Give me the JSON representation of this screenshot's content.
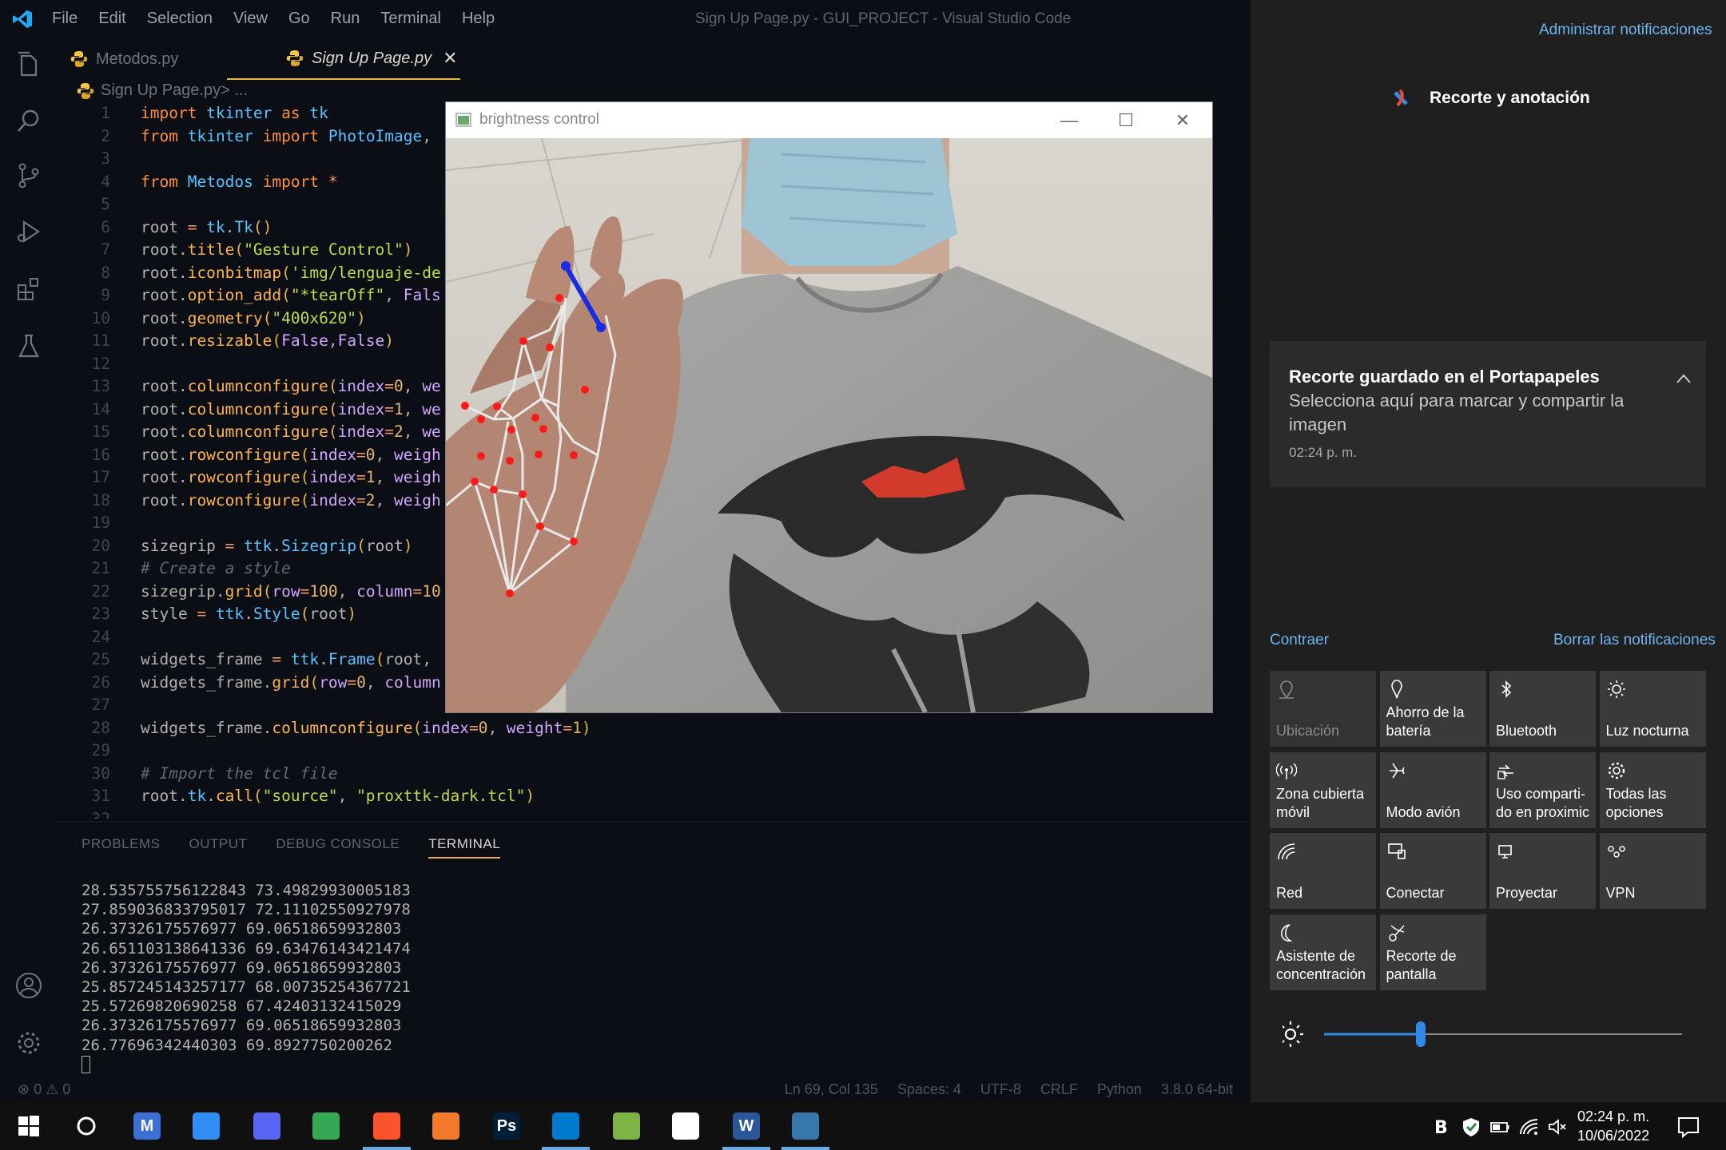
{
  "vscode": {
    "menu": [
      "File",
      "Edit",
      "Selection",
      "View",
      "Go",
      "Run",
      "Terminal",
      "Help"
    ],
    "window_title": "Sign Up Page.py - GUI_PROJECT - Visual Studio Code",
    "tabs": [
      {
        "label": "Metodos.py",
        "active": false
      },
      {
        "label": "Sign Up Page.py",
        "active": true,
        "close": "✕"
      }
    ],
    "breadcrumb": {
      "file": "Sign Up Page.py",
      "rest": " > ..."
    },
    "code_lines": [
      {
        "n": "1",
        "html": "<span class='kw'>import</span> <span class='mod'>tkinter</span> <span class='kw'>as</span> <span class='mod'>tk</span>"
      },
      {
        "n": "2",
        "html": "<span class='kw'>from</span> <span class='mod'>tkinter</span> <span class='kw'>import</span> <span class='mod'>PhotoImage</span>,"
      },
      {
        "n": "3",
        "html": ""
      },
      {
        "n": "4",
        "html": "<span class='kw'>from</span> <span class='mod'>Metodos</span> <span class='kw'>import</span> <span class='op'>*</span>"
      },
      {
        "n": "5",
        "html": ""
      },
      {
        "n": "6",
        "html": "root <span class='op'>=</span> <span class='mod'>tk</span>.<span class='mod'>Tk</span><span class='par'>()</span>"
      },
      {
        "n": "7",
        "html": "root.<span class='fn'>title</span><span class='par'>(</span><span class='str'>\"Gesture Control\"</span><span class='par'>)</span>"
      },
      {
        "n": "8",
        "html": "root.<span class='fn'>iconbitmap</span><span class='par'>(</span><span class='str'>'img/lenguaje-de</span>"
      },
      {
        "n": "9",
        "html": "root.<span class='fn'>option_add</span><span class='par'>(</span><span class='str'>\"*tearOff\"</span>, <span class='prm'>Fals</span>"
      },
      {
        "n": "10",
        "html": "root.<span class='fn'>geometry</span><span class='par'>(</span><span class='str'>\"400x620\"</span><span class='par'>)</span>"
      },
      {
        "n": "11",
        "html": "root.<span class='fn'>resizable</span><span class='par'>(</span><span class='prm'>False</span>,<span class='prm'>False</span><span class='par'>)</span>"
      },
      {
        "n": "12",
        "html": ""
      },
      {
        "n": "13",
        "html": "root.<span class='fn'>columnconfigure</span><span class='par'>(</span><span class='prm'>index</span><span class='op'>=</span><span class='num'>0</span>, <span class='prm'>we</span>"
      },
      {
        "n": "14",
        "html": "root.<span class='fn'>columnconfigure</span><span class='par'>(</span><span class='prm'>index</span><span class='op'>=</span><span class='num'>1</span>, <span class='prm'>we</span>"
      },
      {
        "n": "15",
        "html": "root.<span class='fn'>columnconfigure</span><span class='par'>(</span><span class='prm'>index</span><span class='op'>=</span><span class='num'>2</span>, <span class='prm'>we</span>"
      },
      {
        "n": "16",
        "html": "root.<span class='fn'>rowconfigure</span><span class='par'>(</span><span class='prm'>index</span><span class='op'>=</span><span class='num'>0</span>, <span class='prm'>weigh</span>"
      },
      {
        "n": "17",
        "html": "root.<span class='fn'>rowconfigure</span><span class='par'>(</span><span class='prm'>index</span><span class='op'>=</span><span class='num'>1</span>, <span class='prm'>weigh</span>"
      },
      {
        "n": "18",
        "html": "root.<span class='fn'>rowconfigure</span><span class='par'>(</span><span class='prm'>index</span><span class='op'>=</span><span class='num'>2</span>, <span class='prm'>weigh</span>"
      },
      {
        "n": "19",
        "html": ""
      },
      {
        "n": "20",
        "html": "sizegrip <span class='op'>=</span> <span class='mod'>ttk</span>.<span class='mod'>Sizegrip</span><span class='par'>(</span>root<span class='par'>)</span>"
      },
      {
        "n": "21",
        "html": "<span class='cm'># Create a style</span>"
      },
      {
        "n": "22",
        "html": "sizegrip.<span class='fn'>grid</span><span class='par'>(</span><span class='prm'>row</span><span class='op'>=</span><span class='num'>100</span>, <span class='prm'>column</span><span class='op'>=</span><span class='num'>10</span>"
      },
      {
        "n": "23",
        "html": "style <span class='op'>=</span> <span class='mod'>ttk</span>.<span class='mod'>Style</span><span class='par'>(</span>root<span class='par'>)</span>"
      },
      {
        "n": "24",
        "html": ""
      },
      {
        "n": "25",
        "html": "widgets_frame <span class='op'>=</span> <span class='mod'>ttk</span>.<span class='mod'>Frame</span><span class='par'>(</span>root,"
      },
      {
        "n": "26",
        "html": "widgets_frame.<span class='fn'>grid</span><span class='par'>(</span><span class='prm'>row</span><span class='op'>=</span><span class='num'>0</span>, <span class='prm'>column</span>"
      },
      {
        "n": "27",
        "html": ""
      },
      {
        "n": "28",
        "html": "widgets_frame.<span class='fn'>columnconfigure</span><span class='par'>(</span><span class='prm'>index</span><span class='op'>=</span><span class='num'>0</span>, <span class='prm'>weight</span><span class='op'>=</span><span class='num'>1</span><span class='par'>)</span>"
      },
      {
        "n": "29",
        "html": ""
      },
      {
        "n": "30",
        "html": "<span class='cm'># Import the tcl file</span>"
      },
      {
        "n": "31",
        "html": "root.<span class='mod'>tk</span>.<span class='fn'>call</span><span class='par'>(</span><span class='str'>\"source\"</span>, <span class='str'>\"proxttk-dark.tcl\"</span><span class='par'>)</span>"
      },
      {
        "n": "32",
        "html": ""
      }
    ],
    "panel_tabs": [
      "PROBLEMS",
      "OUTPUT",
      "DEBUG CONSOLE",
      "TERMINAL"
    ],
    "panel_active": "TERMINAL",
    "terminal_lines": [
      "28.535755756122843 73.49829930005183",
      "27.859036833795017 72.11102550927978",
      "26.37326175576977 69.06518659932803",
      "26.651103138641336 69.63476143421474",
      "26.37326175576977 69.06518659932803",
      "25.857245143257177 68.00735254367721",
      "25.57269820690258 67.42403132415029",
      "26.37326175576977 69.06518659932803",
      "26.77696342440303 69.8927750200262"
    ],
    "status_left": "⊗ 0 ⚠ 0",
    "status_right": [
      "Ln 69, Col 135",
      "Spaces: 4",
      "UTF-8",
      "CRLF",
      "Python",
      "3.8.0 64-bit"
    ]
  },
  "brightness_window": {
    "title": "brightness control",
    "controls": [
      "—",
      "☐",
      "✕"
    ]
  },
  "action_center": {
    "manage": "Administrar notificaciones",
    "app_name": "Recorte y anotación",
    "notification": {
      "title": "Recorte guardado en el Portapapeles",
      "body": "Selecciona aquí para marcar y compartir la imagen",
      "time": "02:24 p. m."
    },
    "collapse": "Contraer",
    "clear": "Borrar las notificaciones",
    "tiles": [
      {
        "label": "Ubicación",
        "icon": "location-icon",
        "dim": true
      },
      {
        "label": "Ahorro de la\nbatería",
        "icon": "battery-saver-icon",
        "dim": false
      },
      {
        "label": "Bluetooth",
        "icon": "bluetooth-icon",
        "dim": false
      },
      {
        "label": "Luz nocturna",
        "icon": "night-light-icon",
        "dim": false
      },
      {
        "label": "Zona cubierta\nmóvil",
        "icon": "hotspot-icon",
        "dim": false
      },
      {
        "label": "Modo avión",
        "icon": "airplane-icon",
        "dim": false
      },
      {
        "label": "Uso comparti-\ndo en proximic",
        "icon": "nearby-share-icon",
        "dim": false
      },
      {
        "label": "Todas las\nopciones",
        "icon": "settings-icon",
        "dim": false
      },
      {
        "label": "Red",
        "icon": "network-icon",
        "dim": false
      },
      {
        "label": "Conectar",
        "icon": "connect-icon",
        "dim": false
      },
      {
        "label": "Proyectar",
        "icon": "project-icon",
        "dim": false
      },
      {
        "label": "VPN",
        "icon": "vpn-icon",
        "dim": false
      },
      {
        "label": "Asistente de\nconcentración",
        "icon": "focus-assist-icon",
        "dim": false
      },
      {
        "label": "Recorte de\npantalla",
        "icon": "snip-icon",
        "dim": false
      }
    ],
    "brightness_level": 0.27
  },
  "taskbar": {
    "apps": [
      {
        "name": "start-button",
        "label": ""
      },
      {
        "name": "cortana-button",
        "label": ""
      },
      {
        "name": "gmail-app",
        "label": "M",
        "color": "#3b6fd6"
      },
      {
        "name": "messenger-app",
        "label": "",
        "color": "#2f8df3"
      },
      {
        "name": "discord-app",
        "label": "",
        "color": "#5865f2"
      },
      {
        "name": "chrome-app",
        "label": "",
        "color": "#34a853"
      },
      {
        "name": "brave-app",
        "label": "",
        "color": "#fb542b"
      },
      {
        "name": "blender-app",
        "label": "",
        "color": "#f5792a"
      },
      {
        "name": "photoshop-app",
        "label": "Ps",
        "color": "#001e36"
      },
      {
        "name": "vscode-app",
        "label": "",
        "color": "#007acc"
      },
      {
        "name": "3d-app",
        "label": "",
        "color": "#7cb342"
      },
      {
        "name": "editor-app",
        "label": "",
        "color": "#ffffff"
      },
      {
        "name": "word-app",
        "label": "W",
        "color": "#2b579a"
      },
      {
        "name": "python-app",
        "label": "",
        "color": "#3776ab"
      }
    ],
    "time": "02:24 p. m.",
    "date": "10/06/2022"
  }
}
